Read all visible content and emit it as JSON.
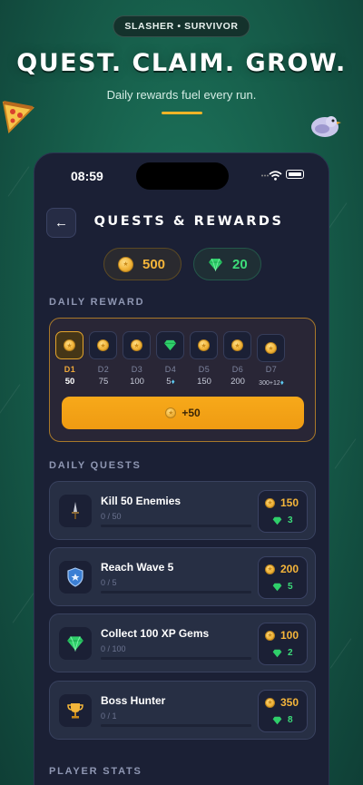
{
  "promo": {
    "brand_pill": "SLASHER • SURVIVOR",
    "headline": "QUEST. CLAIM. GROW.",
    "subheadline": "Daily rewards fuel every run.",
    "accent_color": "#f0b427"
  },
  "status_bar": {
    "time": "08:59"
  },
  "header": {
    "title": "QUESTS & REWARDS",
    "back_icon": "arrow-left-icon"
  },
  "balances": {
    "coins": "500",
    "gems": "20"
  },
  "daily_reward": {
    "section_label": "DAILY REWARD",
    "days": [
      {
        "label": "D1",
        "amount": "50",
        "icon": "coin-icon",
        "active": true
      },
      {
        "label": "D2",
        "amount": "75",
        "icon": "coin-icon",
        "active": false
      },
      {
        "label": "D3",
        "amount": "100",
        "icon": "coin-icon",
        "active": false
      },
      {
        "label": "D4",
        "amount": "5",
        "icon": "gem-icon",
        "active": false
      },
      {
        "label": "D5",
        "amount": "150",
        "icon": "coin-icon",
        "active": false
      },
      {
        "label": "D6",
        "amount": "200",
        "icon": "coin-icon",
        "active": false
      },
      {
        "label": "D7",
        "amount": "300+12",
        "icon": "coin-icon",
        "active": false
      }
    ],
    "claim_label": "+50"
  },
  "daily_quests": {
    "section_label": "DAILY QUESTS",
    "items": [
      {
        "title": "Kill 50 Enemies",
        "progress": "0 / 50",
        "coins": "150",
        "gems": "3",
        "icon": "dagger-icon"
      },
      {
        "title": "Reach Wave 5",
        "progress": "0 / 5",
        "coins": "200",
        "gems": "5",
        "icon": "shield-icon"
      },
      {
        "title": "Collect 100 XP Gems",
        "progress": "0 / 100",
        "coins": "100",
        "gems": "2",
        "icon": "gem-icon"
      },
      {
        "title": "Boss Hunter",
        "progress": "0 / 1",
        "coins": "350",
        "gems": "8",
        "icon": "trophy-icon"
      }
    ]
  },
  "player_stats": {
    "section_label": "PLAYER STATS"
  },
  "colors": {
    "coin": "#f5b53a",
    "gem": "#3ddc7a",
    "claim": "#f7a91a",
    "card_bg": "#272f44"
  }
}
